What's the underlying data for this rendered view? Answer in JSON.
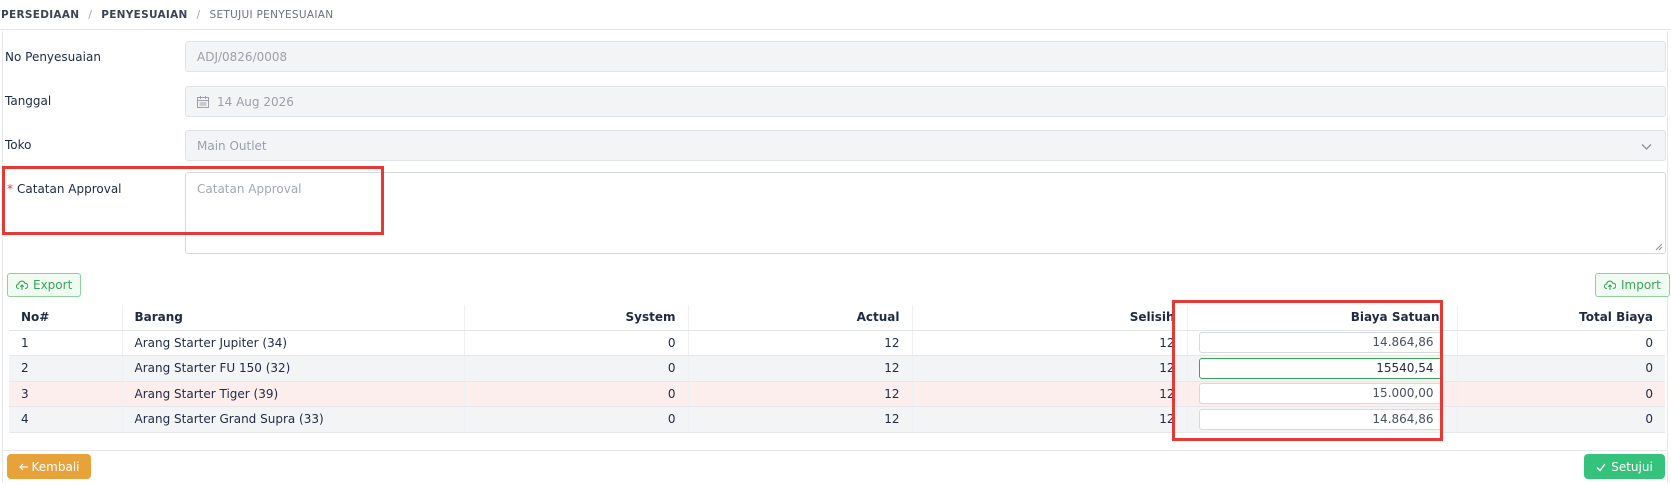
{
  "breadcrumb": {
    "item1": "PERSEDIAAN",
    "item2": "PENYESUAIAN",
    "item3": "SETUJUI PENYESUAIAN",
    "separator": "/"
  },
  "form": {
    "no_label": "No Penyesuaian",
    "no_value": "ADJ/0826/0008",
    "date_label": "Tanggal",
    "date_value": "14 Aug 2026",
    "date_icon": "calendar-icon",
    "store_label": "Toko",
    "store_value": "Main Outlet",
    "store_icon": "chevron-down-icon",
    "note_required": "*",
    "note_label": "Catatan Approval",
    "note_placeholder": "Catatan Approval"
  },
  "toolbar": {
    "export_label": "Export",
    "export_icon": "cloud-upload-icon",
    "import_label": "Import",
    "import_icon": "cloud-upload-icon"
  },
  "table": {
    "headers": {
      "no": "No#",
      "item": "Barang",
      "system": "System",
      "actual": "Actual",
      "diff": "Selisih",
      "unit_cost": "Biaya Satuan",
      "total": "Total Biaya"
    },
    "rows": [
      {
        "no": "1",
        "item": "Arang Starter Jupiter (34)",
        "system": "0",
        "actual": "12",
        "diff": "12",
        "unit_cost": "14.864,86",
        "total": "0"
      },
      {
        "no": "2",
        "item": "Arang Starter FU 150 (32)",
        "system": "0",
        "actual": "12",
        "diff": "12",
        "unit_cost": "15540,54",
        "total": "0"
      },
      {
        "no": "3",
        "item": "Arang Starter Tiger (39)",
        "system": "0",
        "actual": "12",
        "diff": "12",
        "unit_cost": "15.000,00",
        "total": "0"
      },
      {
        "no": "4",
        "item": "Arang Starter Grand Supra (33)",
        "system": "0",
        "actual": "12",
        "diff": "12",
        "unit_cost": "14.864,86",
        "total": "0"
      }
    ]
  },
  "actions": {
    "back_label": "Kembali",
    "back_icon": "arrow-left-icon",
    "approve_label": "Setujui",
    "approve_icon": "check-icon"
  },
  "colors": {
    "accent_green": "#35c27a",
    "back_orange": "#e8a23a",
    "highlight_red": "#e53935"
  }
}
